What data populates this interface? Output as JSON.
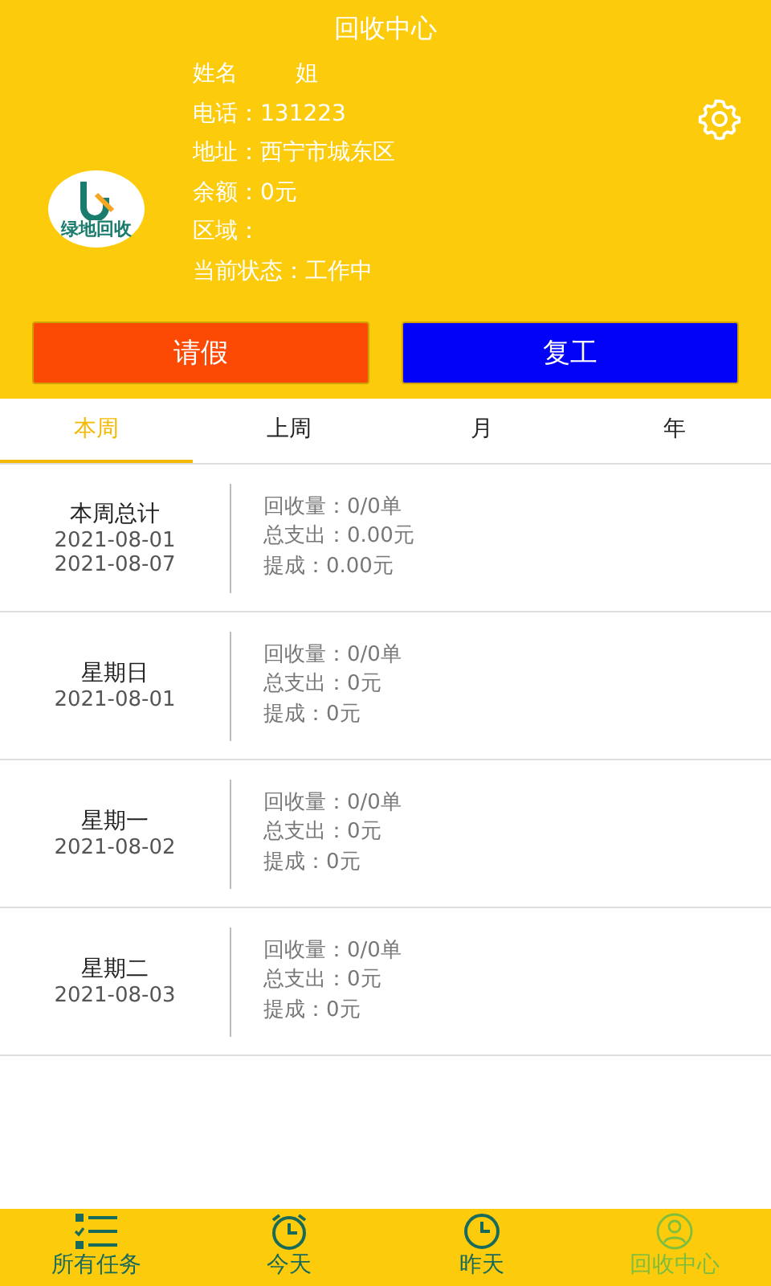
{
  "header": {
    "title": "回收中心"
  },
  "logo": {
    "text": "绿地回收"
  },
  "profile": {
    "name_label": "姓名",
    "name_value": "姐",
    "lines": [
      "电话：131223",
      "地址：西宁市城东区",
      "余额：0元",
      "区域：",
      "当前状态：工作中"
    ]
  },
  "buttons": [
    {
      "label": "请假",
      "color": "#fc4a04"
    },
    {
      "label": "复工",
      "color": "#0202f6"
    }
  ],
  "tabs": [
    {
      "label": "本周",
      "selected": true
    },
    {
      "label": "上周",
      "selected": false
    },
    {
      "label": "月",
      "selected": false
    },
    {
      "label": "年",
      "selected": false
    }
  ],
  "records": [
    {
      "title": "本周总计",
      "dates": [
        "2021-08-01",
        "2021-08-07"
      ],
      "stats": [
        "回收量：0/0单",
        "总支出：0.00元",
        "提成：0.00元"
      ]
    },
    {
      "title": "星期日",
      "dates": [
        "2021-08-01"
      ],
      "stats": [
        "回收量：0/0单",
        "总支出：0元",
        "提成：0元"
      ]
    },
    {
      "title": "星期一",
      "dates": [
        "2021-08-02"
      ],
      "stats": [
        "回收量：0/0单",
        "总支出：0元",
        "提成：0元"
      ]
    },
    {
      "title": "星期二",
      "dates": [
        "2021-08-03"
      ],
      "stats": [
        "回收量：0/0单",
        "总支出：0元",
        "提成：0元"
      ]
    }
  ],
  "nav": [
    {
      "kind": "list",
      "label": "所有任务",
      "selected": false
    },
    {
      "kind": "alarm",
      "label": "今天",
      "selected": false
    },
    {
      "kind": "clock",
      "label": "昨天",
      "selected": false
    },
    {
      "kind": "person",
      "label": "回收中心",
      "selected": true
    }
  ]
}
